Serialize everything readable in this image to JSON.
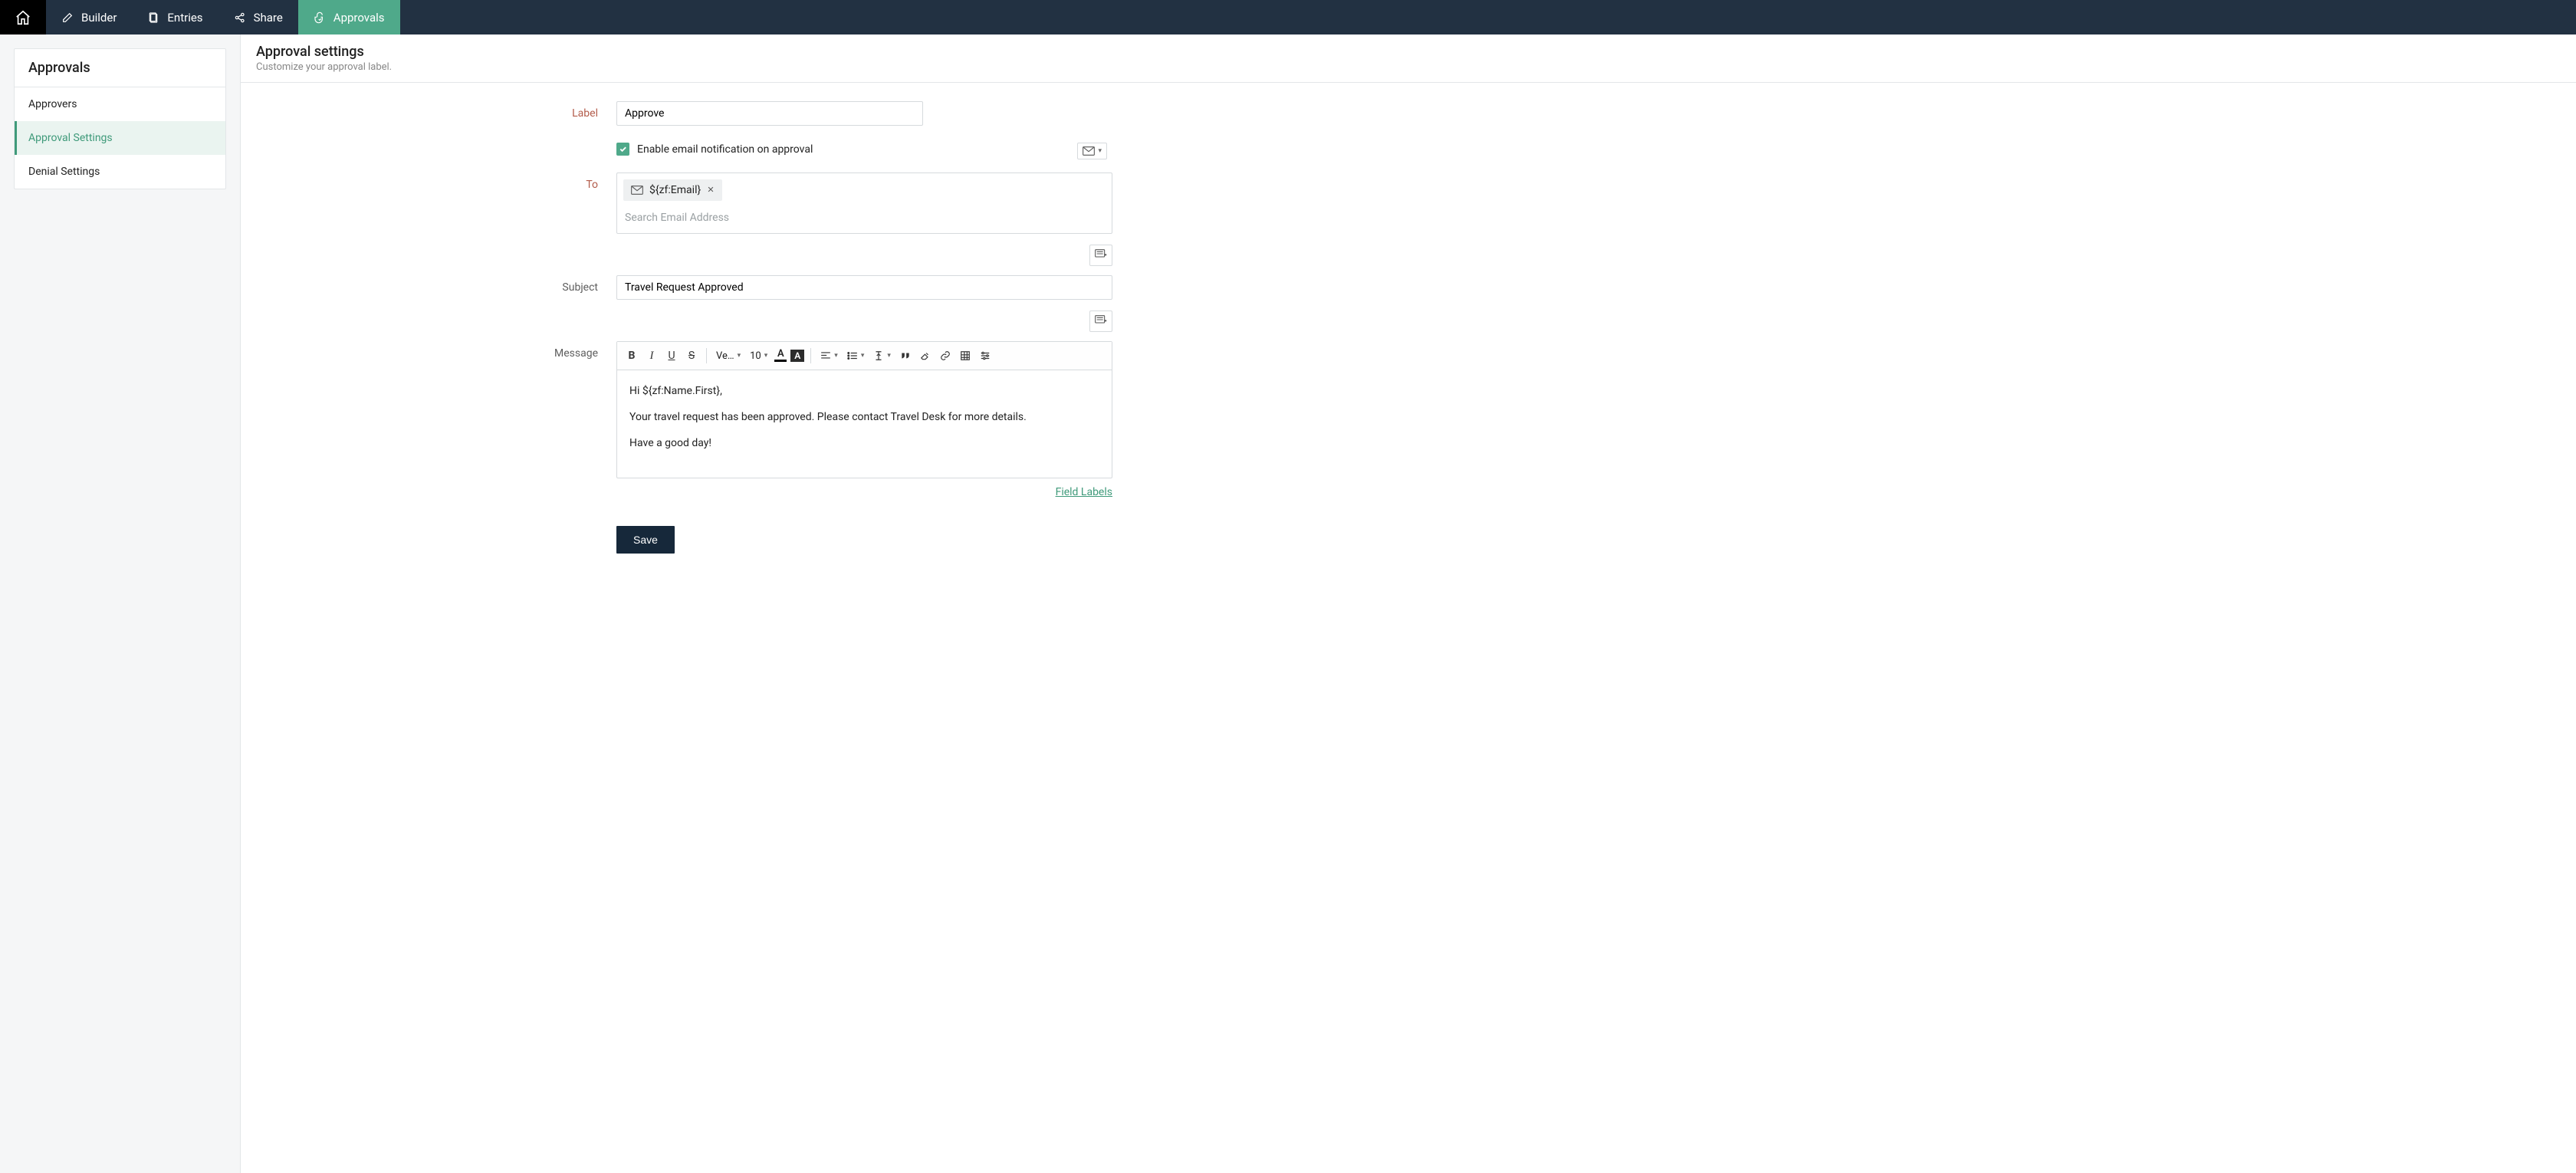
{
  "topnav": {
    "tabs": [
      {
        "label": "Builder"
      },
      {
        "label": "Entries"
      },
      {
        "label": "Share"
      },
      {
        "label": "Approvals"
      }
    ],
    "active_index": 3
  },
  "sidebar": {
    "title": "Approvals",
    "items": [
      {
        "label": "Approvers"
      },
      {
        "label": "Approval Settings"
      },
      {
        "label": "Denial Settings"
      }
    ],
    "active_index": 1
  },
  "page": {
    "title": "Approval settings",
    "subtitle": "Customize your approval label."
  },
  "form": {
    "label_field": {
      "label": "Label",
      "value": "Approve"
    },
    "enable_email": {
      "checked": true,
      "text": "Enable email notification on approval"
    },
    "to": {
      "label": "To",
      "chips": [
        {
          "text": "${zf:Email}"
        }
      ],
      "placeholder": "Search Email Address"
    },
    "subject": {
      "label": "Subject",
      "value": "Travel Request Approved"
    },
    "message": {
      "label": "Message",
      "body_lines": [
        "Hi ${zf:Name.First},",
        "Your travel request has been approved. Please contact Travel Desk for more details.",
        "Have a good day!"
      ]
    },
    "editor_toolbar": {
      "font_family": "Ve…",
      "font_size": "10"
    },
    "field_labels_link": "Field Labels",
    "save_button": "Save"
  }
}
